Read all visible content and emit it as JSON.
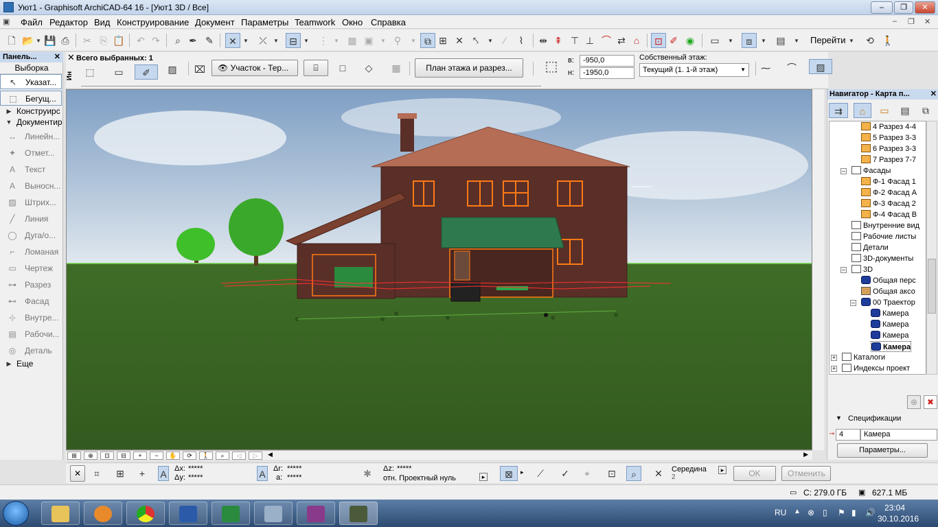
{
  "window": {
    "title": "Уют1 - Graphisoft ArchiCAD-64 16 - [Уют1 3D / Все]",
    "min": "–",
    "max": "❐",
    "close": "✕"
  },
  "menu": [
    "Файл",
    "Редактор",
    "Вид",
    "Конструирование",
    "Документ",
    "Параметры",
    "Teamwork",
    "Окно",
    "Справка"
  ],
  "toolbar1": {
    "goto_label": "Перейти"
  },
  "infobox": {
    "selected": "Всего выбранных: 1",
    "layer": "Участок - Тер...",
    "plan_button": "План этажа и разрез...",
    "b_label": "в:",
    "b_value": "-950,0",
    "h_label": "н:",
    "h_value": "-1950,0",
    "floor_label": "Собственный этаж:",
    "floor_value": "Текущий (1. 1-й этаж)",
    "side_tab": "Ин"
  },
  "leftpanel": {
    "title": "Панель...",
    "tab": "Выборка",
    "items": [
      {
        "label": "Указат...",
        "icon": "↖",
        "active": true
      },
      {
        "label": "Бегущ...",
        "icon": "⬚",
        "active": true
      },
      {
        "label": "Конструирс",
        "icon": "▶",
        "active": true,
        "group": true
      },
      {
        "label": "Документир",
        "icon": "▼",
        "active": true,
        "group": true
      },
      {
        "label": "Линейн...",
        "icon": "↔",
        "active": false
      },
      {
        "label": "Отмет...",
        "icon": "✦",
        "active": false
      },
      {
        "label": "Текст",
        "icon": "A",
        "active": false
      },
      {
        "label": "Выносн...",
        "icon": "A",
        "active": false
      },
      {
        "label": "Штрих...",
        "icon": "▨",
        "active": false
      },
      {
        "label": "Линия",
        "icon": "╱",
        "active": false
      },
      {
        "label": "Дуга/о...",
        "icon": "◯",
        "active": false
      },
      {
        "label": "Ломаная",
        "icon": "⌐",
        "active": false
      },
      {
        "label": "Чертеж",
        "icon": "▭",
        "active": false
      },
      {
        "label": "Разрез",
        "icon": "⊶",
        "active": false
      },
      {
        "label": "Фасад",
        "icon": "⊷",
        "active": false
      },
      {
        "label": "Внутре...",
        "icon": "⊹",
        "active": false
      },
      {
        "label": "Рабочи...",
        "icon": "▤",
        "active": false
      },
      {
        "label": "Деталь",
        "icon": "◎",
        "active": false
      },
      {
        "label": "Еще",
        "icon": "▶",
        "active": true,
        "group": true
      }
    ]
  },
  "navigator": {
    "title": "Навигатор - Карта п...",
    "items": [
      {
        "label": "4 Разрез 4-4",
        "icon": "house",
        "indent": 3
      },
      {
        "label": "5 Разрез 3-3",
        "icon": "house",
        "indent": 3
      },
      {
        "label": "6 Разрез 3-3",
        "icon": "house",
        "indent": 3
      },
      {
        "label": "7 Разрез 7-7",
        "icon": "house",
        "indent": 3
      },
      {
        "label": "Фасады",
        "icon": "doc",
        "indent": 2,
        "exp": "–"
      },
      {
        "label": "Ф-1 Фасад 1",
        "icon": "house",
        "indent": 3
      },
      {
        "label": "Ф-2 Фасад А",
        "icon": "house",
        "indent": 3
      },
      {
        "label": "Ф-3 Фасад 2",
        "icon": "house",
        "indent": 3
      },
      {
        "label": "Ф-4 Фасад В",
        "icon": "house",
        "indent": 3
      },
      {
        "label": "Внутренние вид",
        "icon": "doc",
        "indent": 2
      },
      {
        "label": "Рабочие листы",
        "icon": "doc",
        "indent": 2
      },
      {
        "label": "Детали",
        "icon": "doc",
        "indent": 2
      },
      {
        "label": "3D-документы",
        "icon": "doc",
        "indent": 2
      },
      {
        "label": "3D",
        "icon": "doc",
        "indent": 2,
        "exp": "–"
      },
      {
        "label": "Общая перс",
        "icon": "cam",
        "indent": 3
      },
      {
        "label": "Общая аксо",
        "icon": "box",
        "indent": 3
      },
      {
        "label": "00 Траектор",
        "icon": "cam",
        "indent": 3,
        "exp": "–"
      },
      {
        "label": "Камера",
        "icon": "cam",
        "indent": 4
      },
      {
        "label": "Камера",
        "icon": "cam",
        "indent": 4
      },
      {
        "label": "Камера",
        "icon": "cam",
        "indent": 4
      },
      {
        "label": "Камера",
        "icon": "cam",
        "indent": 4,
        "bold": true
      },
      {
        "label": "Каталоги",
        "icon": "doc",
        "indent": 1,
        "exp": "+"
      },
      {
        "label": "Индексы проект",
        "icon": "doc",
        "indent": 1,
        "exp": "+"
      }
    ],
    "spec_label": "Спецификации",
    "spec_id": "4",
    "spec_name": "Камера",
    "params_button": "Параметры..."
  },
  "coords": {
    "dx_label": "Δx:",
    "dx": "*****",
    "dy_label": "Δy:",
    "dy": "*****",
    "r_label": "Δr:",
    "r": "*****",
    "a_label": "a:",
    "a": "*****",
    "dz_label": "Δz:",
    "dz": "*****",
    "ref": "отн. Проектный нуль",
    "snap_label": "Середина",
    "snap_value": "2",
    "ok": "OK",
    "cancel": "Отменить"
  },
  "status": {
    "disk": "С: 279.0 ГБ",
    "mem": "627.1 МБ"
  },
  "taskbar": {
    "lang": "RU",
    "time": "23:04",
    "date": "30.10.2016"
  },
  "colors": {
    "wall": "#5a2f28",
    "roof": "#b56d55",
    "trim": "#ff7a14",
    "awning": "#2e7a4e",
    "grass": "#3d6b22"
  }
}
